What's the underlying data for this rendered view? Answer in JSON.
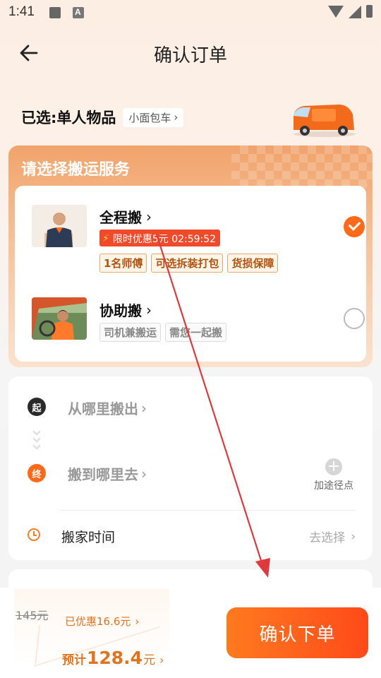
{
  "status_bar": {
    "time": "1:41"
  },
  "nav": {
    "title": "确认订单"
  },
  "selection": {
    "label": "已选:单人物品",
    "vehicle": "小面包车"
  },
  "service": {
    "title": "请选择搬运服务",
    "options": [
      {
        "name": "全程搬",
        "selected": true,
        "promo": "限时优惠5元 02:59:52",
        "tags": [
          "1名师傅",
          "可选拆装打包",
          "货损保障"
        ]
      },
      {
        "name": "协助搬",
        "selected": false,
        "tags": [
          "司机兼搬运",
          "需您一起搬"
        ]
      }
    ]
  },
  "address": {
    "start_badge": "起",
    "start_placeholder": "从哪里搬出",
    "end_badge": "终",
    "end_placeholder": "搬到哪里去",
    "add_stop": "加途径点",
    "time_label": "搬家时间",
    "time_action": "去选择"
  },
  "footer": {
    "original_price": "145元",
    "discount": "已优惠16.6元",
    "estimate_prefix": "预计",
    "estimate_amount": "128.4",
    "estimate_unit": "元",
    "confirm": "确认下单"
  },
  "colors": {
    "accent": "#ff6a1a",
    "annotation_arrow": "#e0393b"
  }
}
